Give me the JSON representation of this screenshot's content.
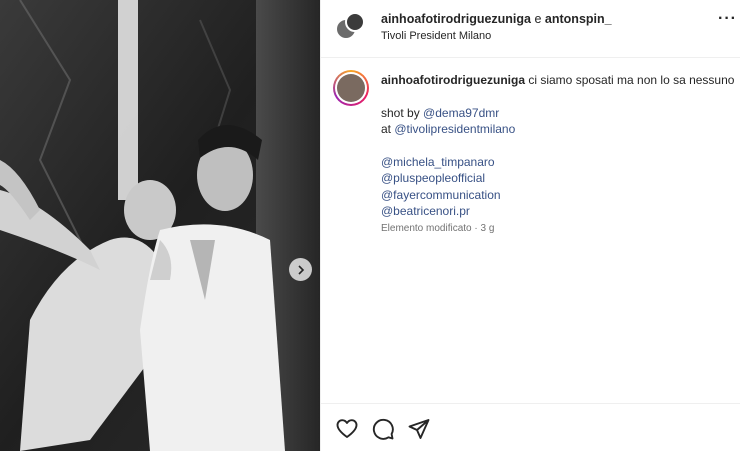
{
  "header": {
    "user_one": "ainhoafotirodriguezuniga",
    "conjunction": "e",
    "user_two": "antonspin_",
    "location": "Tivoli President Milano",
    "more_label": "···"
  },
  "caption": {
    "username": "ainhoafotirodriguezuniga",
    "text": "ci siamo sposati ma non lo sa nessuno",
    "shot_by_prefix": "shot by",
    "shot_by_mention": "@dema97dmr",
    "at_prefix": "at",
    "at_mention": "@tivolipresidentmilano",
    "tags": [
      "@michela_timpanaro",
      "@pluspeopleofficial",
      "@fayercommunication",
      "@beatricenori.pr"
    ],
    "meta": "Elemento modificato · 3 g"
  },
  "icons": {
    "next": "chevron-right-icon",
    "like": "heart-icon",
    "comment": "comment-icon",
    "share": "send-icon"
  },
  "colors": {
    "mention": "#385185",
    "text": "#262626",
    "muted": "#737373"
  }
}
